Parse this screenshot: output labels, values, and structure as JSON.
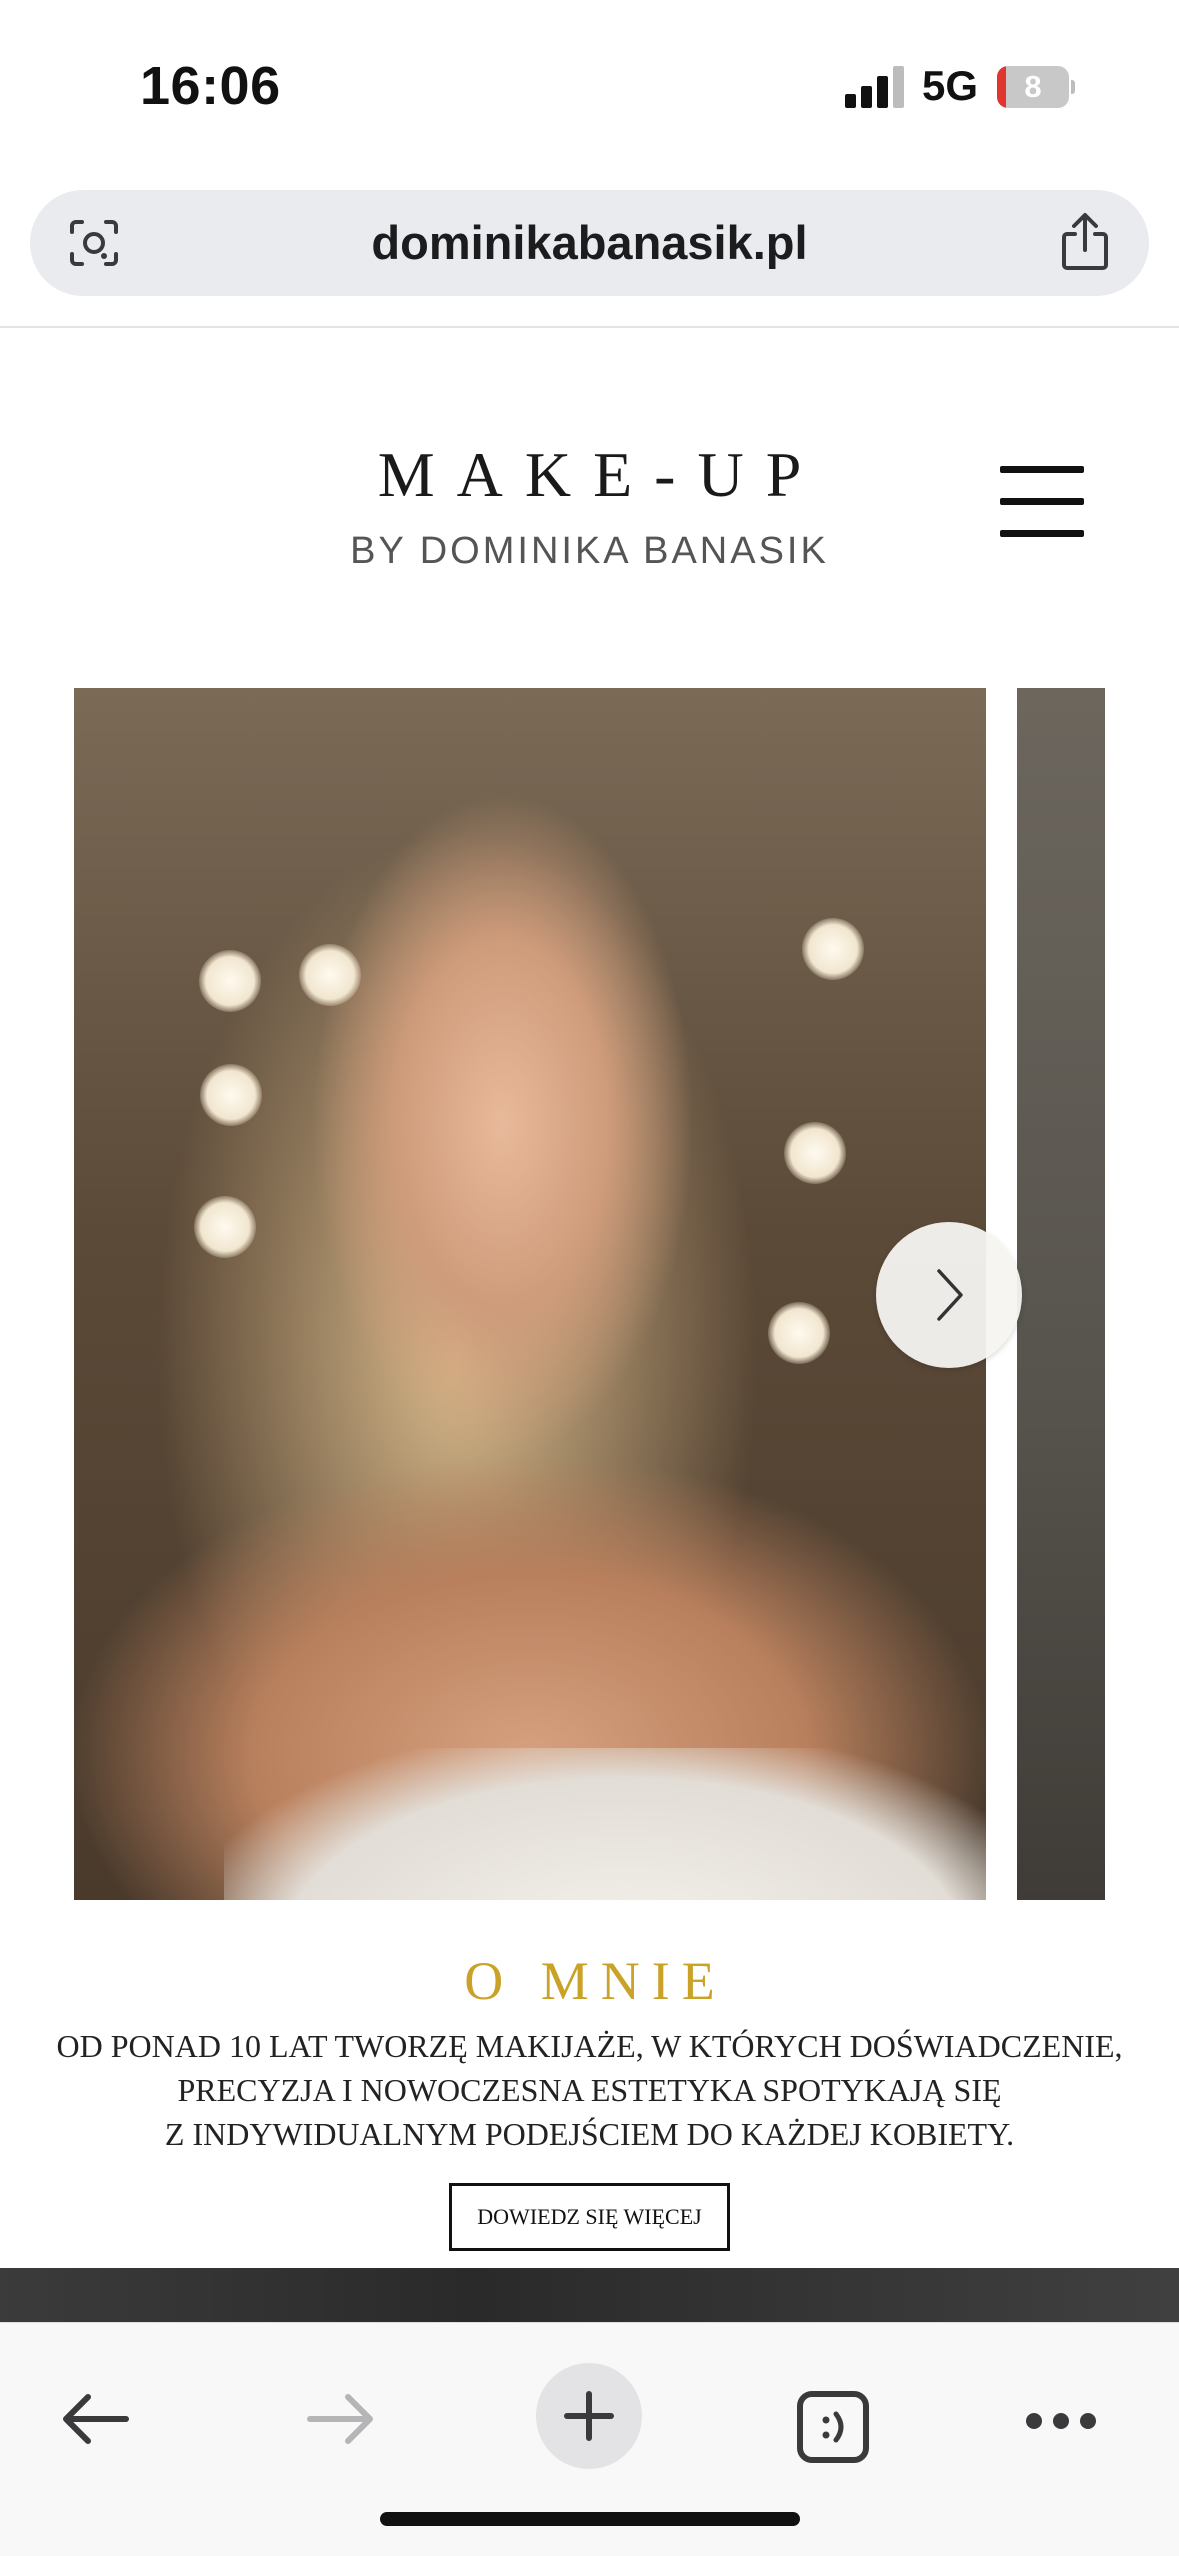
{
  "status_bar": {
    "time": "16:06",
    "network": "5G",
    "battery_level": "8",
    "battery_fraction": 0.08
  },
  "browser": {
    "url": "dominikabanasik.pl",
    "lens_icon": "camera-search-icon",
    "share_icon": "share-icon"
  },
  "header": {
    "brand_title": "MAKE-UP",
    "brand_subtitle": "BY DOMINIKA BANASIK",
    "menu_icon": "hamburger-menu-icon"
  },
  "slider": {
    "next_icon": "chevron-right-icon"
  },
  "about": {
    "title": "O MNIE",
    "lines": [
      "Od ponad 10 lat tworzę makijaże, w których doświadczenie,",
      "precyzja i nowoczesna estetyka spotykają się",
      "z indywidualnym podejściem do każdej kobiety."
    ],
    "button_label": "DOWIEDZ SIĘ WIĘCEJ"
  },
  "toolbar": {
    "items": [
      "back-arrow-icon",
      "forward-arrow-icon",
      "plus-icon",
      "tabs-icon",
      "more-dots-icon"
    ]
  },
  "colors": {
    "accent_gold": "#c9a227",
    "battery_low": "#e0362f",
    "url_bar_bg": "#e9ebee"
  }
}
